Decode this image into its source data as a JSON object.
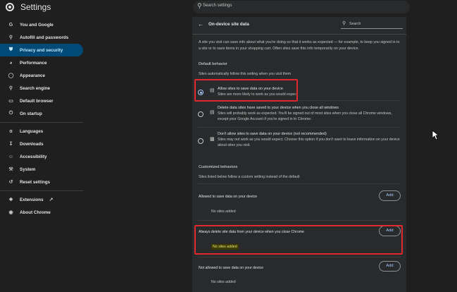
{
  "app": {
    "title": "Settings",
    "search_placeholder": "Search settings"
  },
  "sidebar": {
    "items": [
      {
        "label": "You and Google",
        "icon": "google-icon"
      },
      {
        "label": "Autofill and passwords",
        "icon": "key-icon"
      },
      {
        "label": "Privacy and security",
        "icon": "shield-icon",
        "active": true
      },
      {
        "label": "Performance",
        "icon": "speedometer-icon"
      },
      {
        "label": "Appearance",
        "icon": "palette-icon"
      },
      {
        "label": "Search engine",
        "icon": "search-icon"
      },
      {
        "label": "Default browser",
        "icon": "browser-icon"
      },
      {
        "label": "On startup",
        "icon": "power-icon"
      },
      {
        "label": "Languages",
        "icon": "translate-icon"
      },
      {
        "label": "Downloads",
        "icon": "download-icon"
      },
      {
        "label": "Accessibility",
        "icon": "accessibility-icon"
      },
      {
        "label": "System",
        "icon": "wrench-icon"
      },
      {
        "label": "Reset settings",
        "icon": "reset-icon"
      },
      {
        "label": "Extensions",
        "icon": "puzzle-icon"
      },
      {
        "label": "About Chrome",
        "icon": "chrome-icon"
      }
    ]
  },
  "panel": {
    "title": "On-device site data",
    "search_placeholder": "Search",
    "intro": "A site you visit can save info about what you're doing so that it works as expected — for example, to keep you signed in to a site or to save items in your shopping cart. Often sites save this info temporarily on your device.",
    "default_behavior": {
      "title": "Default behavior",
      "subtitle": "Sites automatically follow this setting when you visit them",
      "options": [
        {
          "label": "Allow sites to save data on your device",
          "desc": "Sites are more likely to work as you would expect",
          "checked": true,
          "icon": "database-icon"
        },
        {
          "label": "Delete data sites have saved to your device when you close all windows",
          "desc": "Sites will probably work as expected. You'll be signed out of most sites when you close all Chrome windows, except your Google Account if you're signed in to Chrome.",
          "checked": false,
          "icon": "database-icon"
        },
        {
          "label": "Don't allow sites to save data on your device (not recommended)",
          "desc": "Sites may not work as you would expect. Choose this option if you don't want to leave information on your device about sites you visit.",
          "checked": false,
          "icon": "database-blocked-icon"
        }
      ]
    },
    "customized": {
      "title": "Customized behaviors",
      "subtitle": "Sites listed below follow a custom setting instead of the default",
      "groups": [
        {
          "label": "Allowed to save data on your device",
          "add_label": "Add",
          "empty": "No sites added"
        },
        {
          "label": "Always delete site data from your device when you close Chrome",
          "add_label": "Add",
          "empty": "No sites added"
        },
        {
          "label": "Not allowed to save data on your device",
          "add_label": "Add",
          "empty": "No sites added"
        }
      ]
    }
  },
  "colors": {
    "background": "#1f1f1f",
    "panel": "#282a2c",
    "active_nav": "#004a77",
    "accent": "#a8c7fa",
    "highlight_box": "#e0282f"
  }
}
